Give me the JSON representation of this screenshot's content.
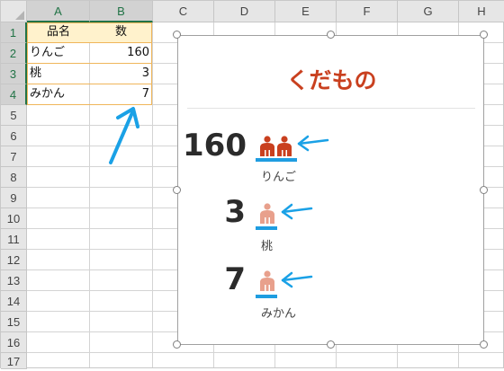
{
  "spreadsheet": {
    "columns": [
      "A",
      "B",
      "C",
      "D",
      "E",
      "F",
      "G",
      "H"
    ],
    "rows": [
      "1",
      "2",
      "3",
      "4",
      "5",
      "6",
      "7",
      "8",
      "9",
      "10",
      "11",
      "12",
      "13",
      "14",
      "15",
      "16",
      "17"
    ],
    "table": {
      "header": {
        "name": "品名",
        "count": "数"
      },
      "items": [
        {
          "name": "りんご",
          "count": "160"
        },
        {
          "name": "桃",
          "count": "3"
        },
        {
          "name": "みかん",
          "count": "7"
        }
      ]
    }
  },
  "chart": {
    "title": "くだもの",
    "entries": [
      {
        "value": "160",
        "label": "りんご",
        "icon": "person-pair-icon"
      },
      {
        "value": "3",
        "label": "桃",
        "icon": "person-icon"
      },
      {
        "value": "7",
        "label": "みかん",
        "icon": "person-icon"
      }
    ]
  },
  "colors": {
    "title": "#c9401f",
    "icon_full": "#c9401f",
    "icon_light": "#e8a08c",
    "underline": "#1f9de0",
    "arrow": "#1aa1e6",
    "table_header": "#fff2cc"
  }
}
